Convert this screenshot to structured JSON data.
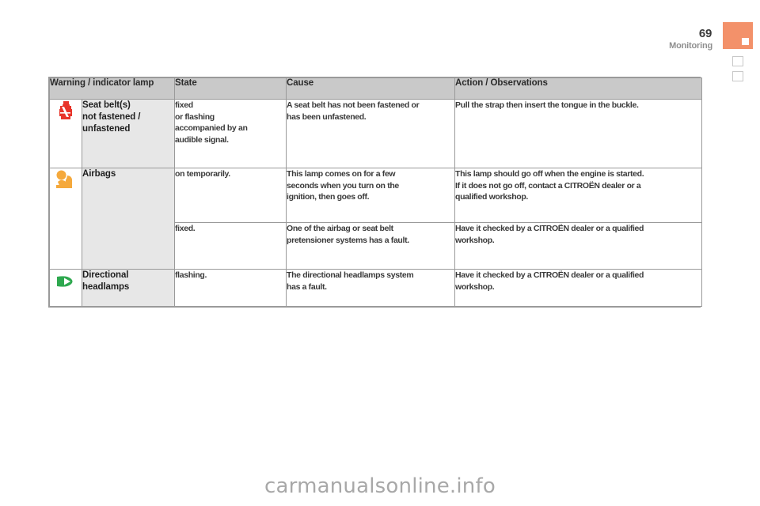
{
  "header": {
    "page_number": "69",
    "chapter": "Monitoring",
    "tab_color": "#f3916a"
  },
  "table": {
    "columns": [
      "Warning / indicator lamp",
      "State",
      "Cause",
      "Action / Observations"
    ],
    "rows": [
      {
        "icon": "seat-belt-warning-icon",
        "icon_color": "#e8342a",
        "lamp": "Seat belt(s)\nnot fastened /\nunfastened",
        "state": "fixed\nor flashing\naccompanied by an\naudible signal.",
        "cause": "A seat belt has not been fastened or\nhas been unfastened.",
        "action": "Pull the strap then insert the tongue in the buckle."
      },
      {
        "icon": "airbag-warning-icon",
        "icon_color": "#f5a93c",
        "lamp": "Airbags",
        "state": "on temporarily.",
        "cause": "This lamp comes on for a few\nseconds when you turn on the\nignition, then goes off.",
        "action": "This lamp should go off when the engine is started.\nIf it does not go off, contact a CITROËN dealer or a\nqualified workshop."
      },
      {
        "icon": "",
        "icon_color": "",
        "lamp": "",
        "state": "fixed.",
        "cause": "One of the airbag or seat belt\npretensioner systems has a fault.",
        "action": "Have it checked by a CITROËN dealer or a qualified\nworkshop."
      },
      {
        "icon": "directional-headlamps-icon",
        "icon_color": "#2ea84f",
        "lamp": "Directional\nheadlamps",
        "state": "flashing.",
        "cause": "The directional headlamps system\nhas a fault.",
        "action": "Have it checked by a CITROËN dealer or a qualified\nworkshop."
      }
    ]
  },
  "footer": {
    "watermark": "carmanualsonline.info"
  }
}
